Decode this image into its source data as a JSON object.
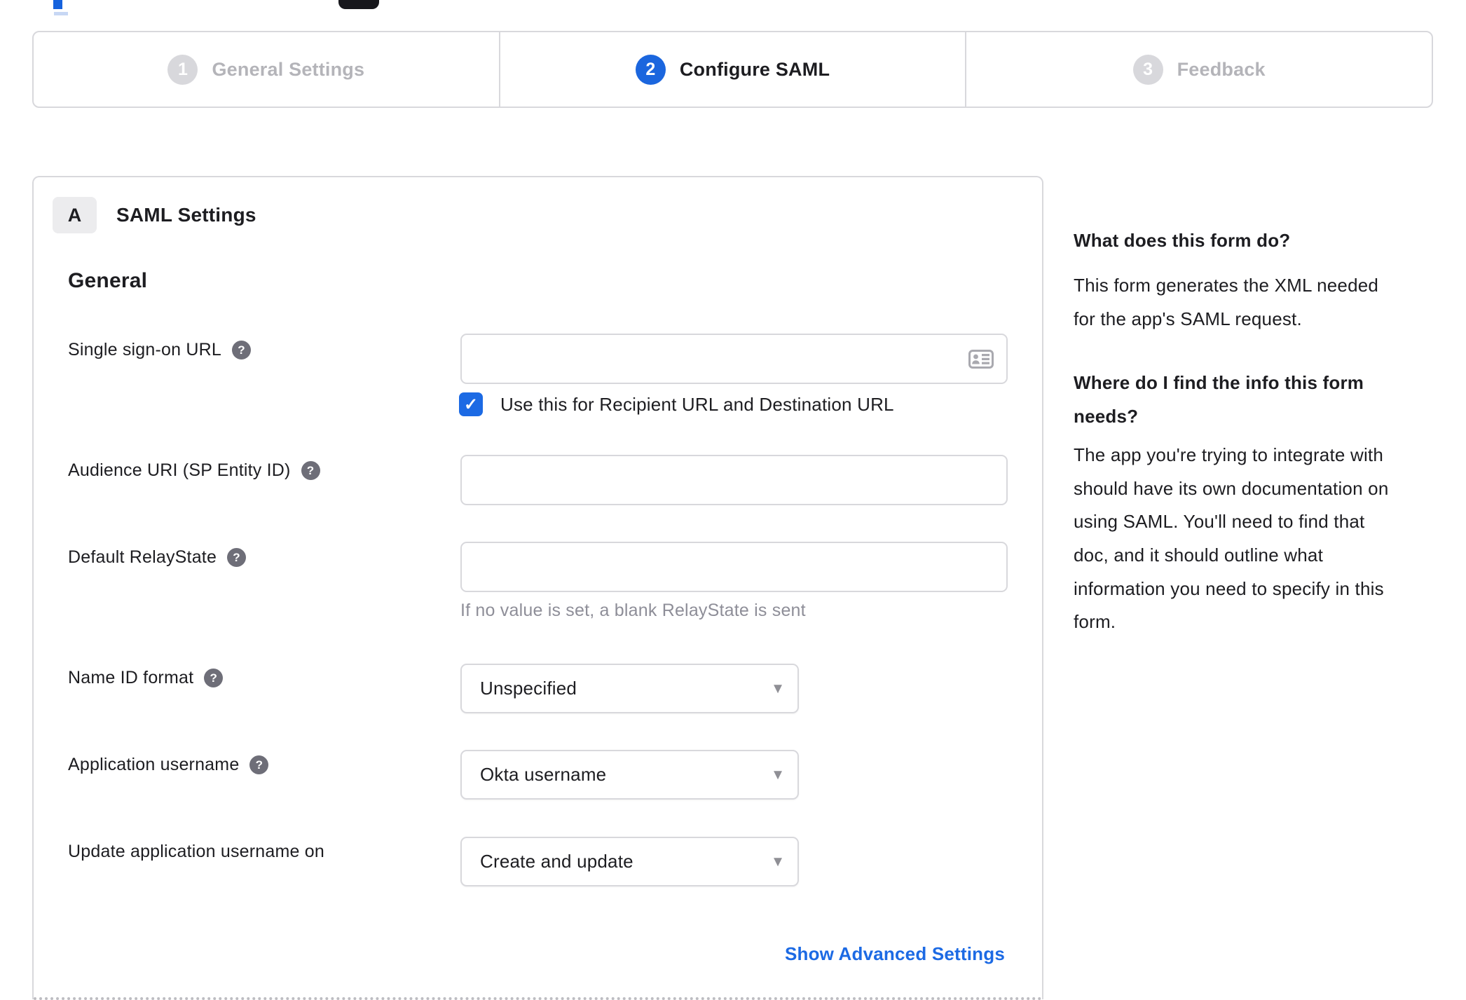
{
  "stepper": {
    "steps": [
      {
        "number": "1",
        "label": "General Settings",
        "state": "inactive"
      },
      {
        "number": "2",
        "label": "Configure SAML",
        "state": "active"
      },
      {
        "number": "3",
        "label": "Feedback",
        "state": "inactive"
      }
    ]
  },
  "form": {
    "section": {
      "badge": "A",
      "title": "SAML Settings"
    },
    "heading": "General",
    "sso": {
      "label": "Single sign-on URL",
      "value": "",
      "checkbox_checked": true,
      "checkbox_label": "Use this for Recipient URL and Destination URL"
    },
    "audience": {
      "label": "Audience URI (SP Entity ID)",
      "value": ""
    },
    "relay_state": {
      "label": "Default RelayState",
      "value": "",
      "helper": "If no value is set, a blank RelayState is sent"
    },
    "name_id_format": {
      "label": "Name ID format",
      "value": "Unspecified"
    },
    "app_username": {
      "label": "Application username",
      "value": "Okta username"
    },
    "update_app_username": {
      "label": "Update application username on",
      "value": "Create and update"
    },
    "advanced_link": "Show Advanced Settings"
  },
  "help_panel": {
    "heading1": "What does this form do?",
    "para1": "This form generates the XML needed\nfor the app's SAML request.",
    "heading2": "Where do I find the info this form\nneeds?",
    "para2": "The app you're trying to integrate with\nshould have its own documentation on\nusing SAML. You'll need to find that\ndoc, and it should outline what\ninformation you need to specify in this\nform."
  },
  "glyphs": {
    "help": "?",
    "check": "✓",
    "dropdown_arrow": "▾"
  },
  "colors": {
    "primary_blue": "#1b66de",
    "checkbox_blue": "#1c6ae4",
    "link_blue": "#1c6ae4",
    "border_gray": "#d8d8dc",
    "inactive_gray": "#b4b4b9",
    "help_icon_gray": "#6e6e78",
    "muted_text": "#8e8e98",
    "text_dark": "#1d1d21",
    "badge_bg": "#ececee"
  }
}
